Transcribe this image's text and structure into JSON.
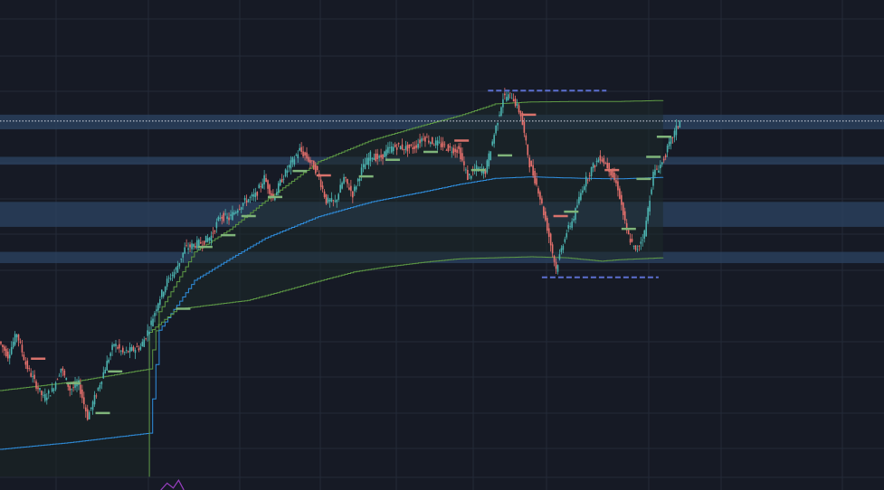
{
  "theme": {
    "background": "#161a25",
    "grid": "#242a38",
    "zone_fill": "#2c4260",
    "candle_up": "#4cb3b0",
    "candle_down": "#e8716d",
    "upper_band": "#5e9a45",
    "mid_band": "#2f8fe0",
    "marker_up": "#7fb47a",
    "marker_down": "#d9736c",
    "dashed_level": "#5c6fd0",
    "price_line": "#d8dce6",
    "volume": "#9b3fc4"
  },
  "chart_data": {
    "type": "candlestick",
    "title": "",
    "xlabel": "",
    "ylabel": "",
    "ylim": [
      0,
      100
    ],
    "xlim": [
      0,
      100
    ],
    "grid": true,
    "zones": [
      {
        "name": "zone-1",
        "from": 73.6,
        "to": 76.6
      },
      {
        "name": "zone-2",
        "from": 66.4,
        "to": 68.0
      },
      {
        "name": "zone-3",
        "from": 53.7,
        "to": 58.8
      },
      {
        "name": "zone-4",
        "from": 46.3,
        "to": 48.6
      }
    ],
    "price_line": 75.3,
    "dashed_levels": [
      {
        "name": "high-level",
        "y": 81.5,
        "x_from": 55.2,
        "x_to": 68.6
      },
      {
        "name": "low-level",
        "y": 43.4,
        "x_from": 61.3,
        "x_to": 74.5
      }
    ],
    "anchor_vline": {
      "x": 16.9,
      "y_from": 2.7,
      "y_to": 32.2
    },
    "price": [
      [
        0,
        30.3
      ],
      [
        1,
        27.4
      ],
      [
        2,
        32.0
      ],
      [
        3,
        25.7
      ],
      [
        4,
        22.1
      ],
      [
        5,
        18.8
      ],
      [
        6,
        20.3
      ],
      [
        7,
        24.9
      ],
      [
        8,
        20.5
      ],
      [
        9,
        21.6
      ],
      [
        10,
        14.9
      ],
      [
        11,
        19.7
      ],
      [
        12,
        25.0
      ],
      [
        13,
        29.9
      ],
      [
        14,
        27.9
      ],
      [
        15,
        28.6
      ],
      [
        16,
        29.2
      ],
      [
        17,
        33.1
      ],
      [
        18,
        38.5
      ],
      [
        19,
        42.6
      ],
      [
        20,
        45.0
      ],
      [
        21,
        49.2
      ],
      [
        22,
        50.0
      ],
      [
        23,
        50.6
      ],
      [
        24,
        51.8
      ],
      [
        25,
        55.9
      ],
      [
        26,
        55.4
      ],
      [
        27,
        57.6
      ],
      [
        28,
        59.2
      ],
      [
        29,
        60.1
      ],
      [
        30,
        63.7
      ],
      [
        31,
        59.5
      ],
      [
        32,
        63.5
      ],
      [
        33,
        66.6
      ],
      [
        34,
        69.4
      ],
      [
        35,
        67.4
      ],
      [
        36,
        64.9
      ],
      [
        37,
        59.0
      ],
      [
        38,
        58.7
      ],
      [
        39,
        63.6
      ],
      [
        40,
        60.4
      ],
      [
        41,
        65.3
      ],
      [
        42,
        68.3
      ],
      [
        43,
        67.6
      ],
      [
        44,
        69.4
      ],
      [
        45,
        70.2
      ],
      [
        46,
        69.7
      ],
      [
        47,
        70.0
      ],
      [
        48,
        72.1
      ],
      [
        49,
        71.0
      ],
      [
        50,
        70.4
      ],
      [
        51,
        69.6
      ],
      [
        52,
        69.4
      ],
      [
        53,
        63.8
      ],
      [
        54,
        65.6
      ],
      [
        55,
        65.1
      ],
      [
        56,
        72.6
      ],
      [
        57,
        80.1
      ],
      [
        58,
        80.5
      ],
      [
        59,
        76.6
      ],
      [
        60,
        66.6
      ],
      [
        61,
        61.2
      ],
      [
        62,
        53.5
      ],
      [
        63,
        45.1
      ],
      [
        64,
        51.8
      ],
      [
        65,
        55.7
      ],
      [
        66,
        61.8
      ],
      [
        67,
        65.5
      ],
      [
        68,
        68.0
      ],
      [
        69,
        65.6
      ],
      [
        70,
        61.7
      ],
      [
        71,
        52.6
      ],
      [
        72,
        48.6
      ],
      [
        73,
        52.5
      ],
      [
        74,
        64.5
      ],
      [
        75,
        66.8
      ],
      [
        76,
        71.4
      ],
      [
        77,
        75.3
      ]
    ],
    "series": [
      {
        "key": "upper",
        "points": [
          [
            0,
            20.3
          ],
          [
            8,
            22.0
          ],
          [
            16.9,
            24.7
          ],
          [
            18,
            36.4
          ],
          [
            22,
            48.6
          ],
          [
            26,
            53.2
          ],
          [
            30,
            59.0
          ],
          [
            36,
            67.0
          ],
          [
            42,
            71.4
          ],
          [
            48,
            74.5
          ],
          [
            52,
            76.4
          ],
          [
            56,
            78.8
          ],
          [
            60,
            79.2
          ],
          [
            66,
            79.3
          ],
          [
            70,
            79.3
          ],
          [
            75,
            79.5
          ]
        ]
      },
      {
        "key": "middle",
        "points": [
          [
            0,
            8.3
          ],
          [
            8,
            9.7
          ],
          [
            16.9,
            11.6
          ],
          [
            18,
            32.6
          ],
          [
            22,
            42.8
          ],
          [
            26,
            47.2
          ],
          [
            30,
            51.4
          ],
          [
            36,
            55.8
          ],
          [
            42,
            58.8
          ],
          [
            48,
            60.9
          ],
          [
            52,
            62.4
          ],
          [
            56,
            63.6
          ],
          [
            60,
            63.9
          ],
          [
            66,
            63.6
          ],
          [
            70,
            63.5
          ],
          [
            75,
            63.8
          ]
        ]
      },
      {
        "key": "lower",
        "points": [
          [
            16.9,
            32.2
          ],
          [
            20,
            36.9
          ],
          [
            24,
            37.8
          ],
          [
            28,
            38.7
          ],
          [
            32,
            40.6
          ],
          [
            36,
            42.6
          ],
          [
            40,
            44.5
          ],
          [
            44,
            45.6
          ],
          [
            48,
            46.5
          ],
          [
            52,
            47.2
          ],
          [
            56,
            47.4
          ],
          [
            60,
            47.6
          ],
          [
            64,
            47.4
          ],
          [
            68,
            46.7
          ],
          [
            70,
            47.0
          ],
          [
            75,
            47.4
          ]
        ]
      }
    ],
    "markers": [
      {
        "x": 3.5,
        "y": 26.8,
        "dir": "down"
      },
      {
        "x": 7.5,
        "y": 21.8,
        "dir": "up"
      },
      {
        "x": 10.8,
        "y": 15.7,
        "dir": "up"
      },
      {
        "x": 12.2,
        "y": 24.2,
        "dir": "up"
      },
      {
        "x": 19.9,
        "y": 37.0,
        "dir": "up"
      },
      {
        "x": 22.4,
        "y": 49.6,
        "dir": "up"
      },
      {
        "x": 25.0,
        "y": 52.0,
        "dir": "up"
      },
      {
        "x": 27.3,
        "y": 55.9,
        "dir": "up"
      },
      {
        "x": 30.3,
        "y": 59.8,
        "dir": "up"
      },
      {
        "x": 33.1,
        "y": 65.1,
        "dir": "up"
      },
      {
        "x": 35.8,
        "y": 64.2,
        "dir": "down"
      },
      {
        "x": 40.6,
        "y": 64.0,
        "dir": "up"
      },
      {
        "x": 43.6,
        "y": 67.4,
        "dir": "up"
      },
      {
        "x": 47.9,
        "y": 69.0,
        "dir": "up"
      },
      {
        "x": 51.4,
        "y": 71.3,
        "dir": "down"
      },
      {
        "x": 53.3,
        "y": 65.3,
        "dir": "up"
      },
      {
        "x": 56.3,
        "y": 68.3,
        "dir": "up"
      },
      {
        "x": 59.0,
        "y": 76.6,
        "dir": "down"
      },
      {
        "x": 62.6,
        "y": 55.9,
        "dir": "down"
      },
      {
        "x": 63.8,
        "y": 56.8,
        "dir": "up"
      },
      {
        "x": 68.4,
        "y": 65.3,
        "dir": "down"
      },
      {
        "x": 70.3,
        "y": 53.3,
        "dir": "up"
      },
      {
        "x": 72.0,
        "y": 63.5,
        "dir": "up"
      },
      {
        "x": 73.1,
        "y": 68.0,
        "dir": "up"
      },
      {
        "x": 74.3,
        "y": 72.1,
        "dir": "up"
      }
    ],
    "volume_hint": [
      [
        18.2,
        0
      ],
      [
        18.9,
        1.4
      ],
      [
        19.6,
        0.4
      ],
      [
        20.2,
        2.0
      ],
      [
        20.8,
        0
      ]
    ]
  }
}
